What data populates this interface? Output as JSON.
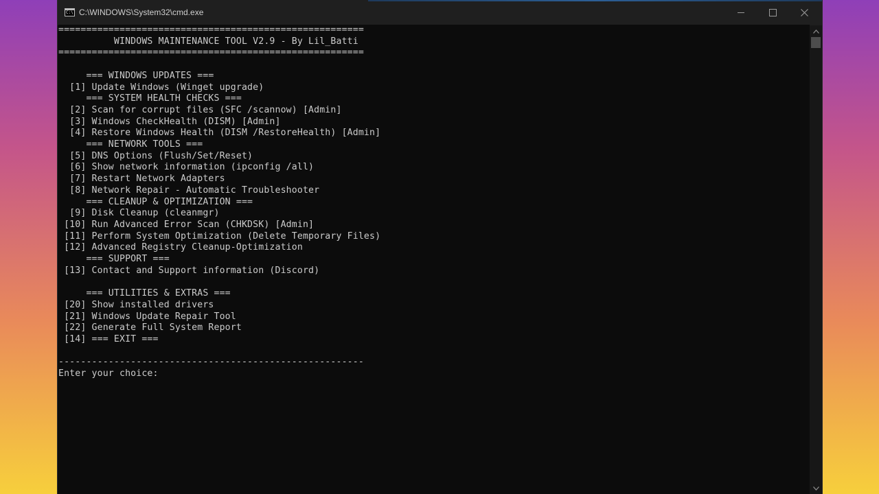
{
  "window": {
    "title": "C:\\WINDOWS\\System32\\cmd.exe",
    "icon": "cmd-icon",
    "controls": {
      "minimize": "minimize-icon",
      "maximize": "maximize-icon",
      "close": "close-icon"
    }
  },
  "console": {
    "lines": [
      "=======================================================",
      "          WINDOWS MAINTENANCE TOOL V2.9 - By Lil_Batti",
      "=======================================================",
      "",
      "     === WINDOWS UPDATES ===",
      "  [1] Update Windows (Winget upgrade)",
      "     === SYSTEM HEALTH CHECKS ===",
      "  [2] Scan for corrupt files (SFC /scannow) [Admin]",
      "  [3] Windows CheckHealth (DISM) [Admin]",
      "  [4] Restore Windows Health (DISM /RestoreHealth) [Admin]",
      "     === NETWORK TOOLS ===",
      "  [5] DNS Options (Flush/Set/Reset)",
      "  [6] Show network information (ipconfig /all)",
      "  [7] Restart Network Adapters",
      "  [8] Network Repair - Automatic Troubleshooter",
      "     === CLEANUP & OPTIMIZATION ===",
      "  [9] Disk Cleanup (cleanmgr)",
      " [10] Run Advanced Error Scan (CHKDSK) [Admin]",
      " [11] Perform System Optimization (Delete Temporary Files)",
      " [12] Advanced Registry Cleanup-Optimization",
      "     === SUPPORT ===",
      " [13] Contact and Support information (Discord)",
      "",
      "     === UTILITIES & EXTRAS ===",
      " [20] Show installed drivers",
      " [21] Windows Update Repair Tool",
      " [22] Generate Full System Report",
      " [14] === EXIT ===",
      "",
      "-------------------------------------------------------",
      "Enter your choice: "
    ]
  },
  "colors": {
    "console_background": "#0c0c0c",
    "console_text": "#cccccc",
    "titlebar_background": "#1f1f1f"
  }
}
